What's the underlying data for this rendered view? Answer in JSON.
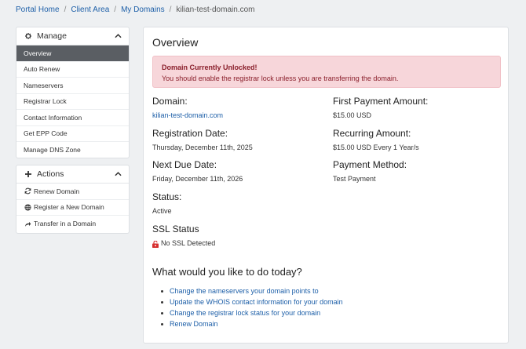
{
  "breadcrumb": {
    "items": [
      "Portal Home",
      "Client Area",
      "My Domains"
    ],
    "current": "kilian-test-domain.com",
    "separator": "/"
  },
  "sidebar": {
    "manage": {
      "title": "Manage",
      "icon": "gear-icon",
      "items": [
        {
          "label": "Overview",
          "active": true
        },
        {
          "label": "Auto Renew"
        },
        {
          "label": "Nameservers"
        },
        {
          "label": "Registrar Lock"
        },
        {
          "label": "Contact Information"
        },
        {
          "label": "Get EPP Code"
        },
        {
          "label": "Manage DNS Zone"
        }
      ]
    },
    "actions": {
      "title": "Actions",
      "icon": "plus-icon",
      "items": [
        {
          "label": "Renew Domain",
          "icon": "sync-icon"
        },
        {
          "label": "Register a New Domain",
          "icon": "globe-icon"
        },
        {
          "label": "Transfer in a Domain",
          "icon": "share-arrow-icon"
        }
      ]
    }
  },
  "main": {
    "title": "Overview",
    "alert": {
      "title": "Domain Currently Unlocked!",
      "message": "You should enable the registrar lock unless you are transferring the domain."
    },
    "fields": {
      "domain": {
        "label": "Domain:",
        "value": "kilian-test-domain.com"
      },
      "registration_date": {
        "label": "Registration Date:",
        "value": "Thursday, December 11th, 2025"
      },
      "next_due_date": {
        "label": "Next Due Date:",
        "value": "Friday, December 11th, 2026"
      },
      "status": {
        "label": "Status:",
        "value": "Active"
      },
      "ssl_status": {
        "label": "SSL Status",
        "value": "No SSL Detected"
      },
      "first_payment": {
        "label": "First Payment Amount:",
        "value": "$15.00 USD"
      },
      "recurring_amount": {
        "label": "Recurring Amount:",
        "value": "$15.00 USD Every 1 Year/s"
      },
      "payment_method": {
        "label": "Payment Method:",
        "value": "Test Payment"
      }
    },
    "question": "What would you like to do today?",
    "links": [
      "Change the nameservers your domain points to",
      "Update the WHOIS contact information for your domain",
      "Change the registrar lock status for your domain",
      "Renew Domain"
    ]
  },
  "colors": {
    "link": "#1d5fa8",
    "active_menu_bg": "#5a5e63",
    "alert_bg": "#f7d6da",
    "alert_text": "#8a1f2b",
    "page_bg": "#eef0f2"
  }
}
